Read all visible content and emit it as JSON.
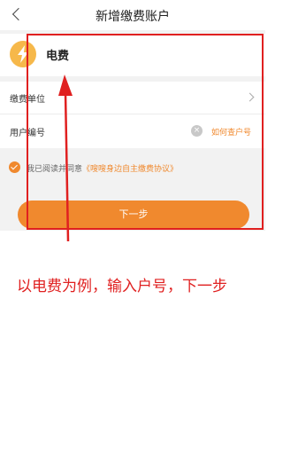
{
  "header": {
    "title": "新增缴费账户",
    "back_icon": "chevron-left-icon"
  },
  "type_card": {
    "name": "电费",
    "icon": "lightning-bolt-icon",
    "icon_color": "#f6b84a"
  },
  "form": {
    "unit_label": "缴费单位",
    "unit_icon": "chevron-right-icon",
    "account_label": "用户编号",
    "account_value": "",
    "clear_icon": "clear-icon",
    "help_link": "如何查户号"
  },
  "agreement": {
    "prefix": "我已阅读并同意",
    "link": "《嗖嗖身边自主缴费协议》",
    "checked": true
  },
  "next_button": "下一步",
  "annotation": "以电费为例，输入户号，下一步",
  "colors": {
    "accent": "#f0892e",
    "annotation": "#e02020",
    "background": "#f2f2f2"
  }
}
